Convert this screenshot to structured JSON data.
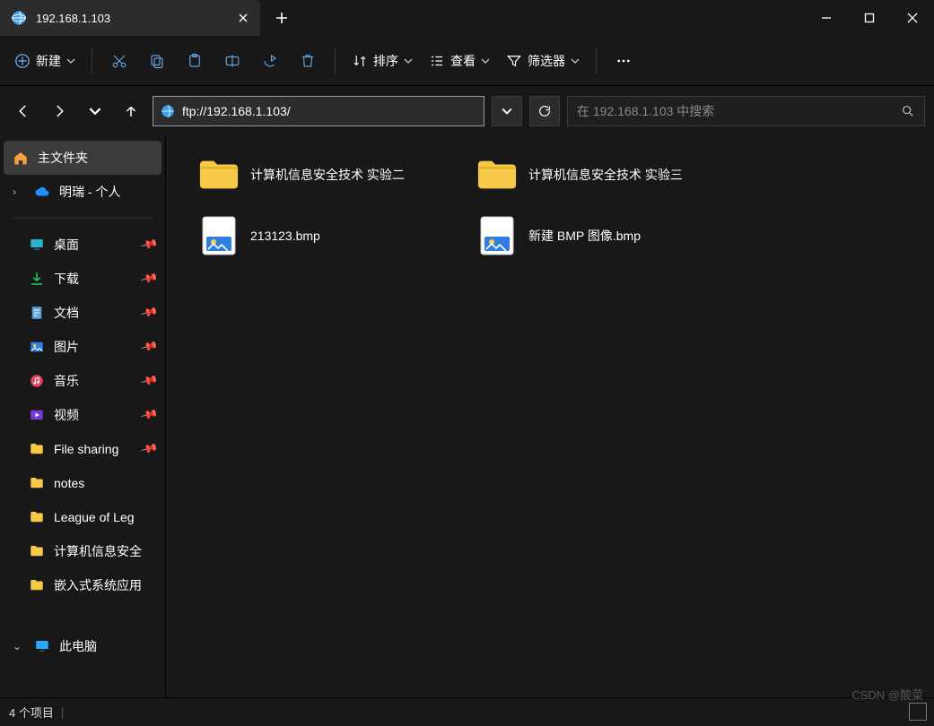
{
  "tab": {
    "title": "192.168.1.103"
  },
  "toolbar": {
    "new_label": "新建",
    "sort_label": "排序",
    "view_label": "查看",
    "filter_label": "筛选器"
  },
  "address": {
    "value": "ftp://192.168.1.103/"
  },
  "search": {
    "placeholder": "在 192.168.1.103 中搜索"
  },
  "sidebar": {
    "home": "主文件夹",
    "onedrive": "明瑞 - 个人",
    "quick": [
      {
        "label": "桌面",
        "icon": "desktop",
        "pinned": true
      },
      {
        "label": "下载",
        "icon": "download",
        "pinned": true
      },
      {
        "label": "文档",
        "icon": "document",
        "pinned": true
      },
      {
        "label": "图片",
        "icon": "pictures",
        "pinned": true
      },
      {
        "label": "音乐",
        "icon": "music",
        "pinned": true
      },
      {
        "label": "视频",
        "icon": "video",
        "pinned": true
      },
      {
        "label": "File sharing",
        "icon": "folder",
        "pinned": true
      },
      {
        "label": "notes",
        "icon": "folder",
        "pinned": false
      },
      {
        "label": "League of Leg",
        "icon": "folder",
        "pinned": false
      },
      {
        "label": "计算机信息安全",
        "icon": "folder",
        "pinned": false
      },
      {
        "label": "嵌入式系统应用",
        "icon": "folder",
        "pinned": false
      }
    ],
    "thispc": "此电脑"
  },
  "files": [
    {
      "name": "计算机信息安全技术 实验二",
      "type": "folder"
    },
    {
      "name": "计算机信息安全技术 实验三",
      "type": "folder"
    },
    {
      "name": "213123.bmp",
      "type": "image"
    },
    {
      "name": "新建 BMP 图像.bmp",
      "type": "image"
    }
  ],
  "status": {
    "count_text": "4 个项目"
  },
  "watermark": "CSDN @酸菜"
}
